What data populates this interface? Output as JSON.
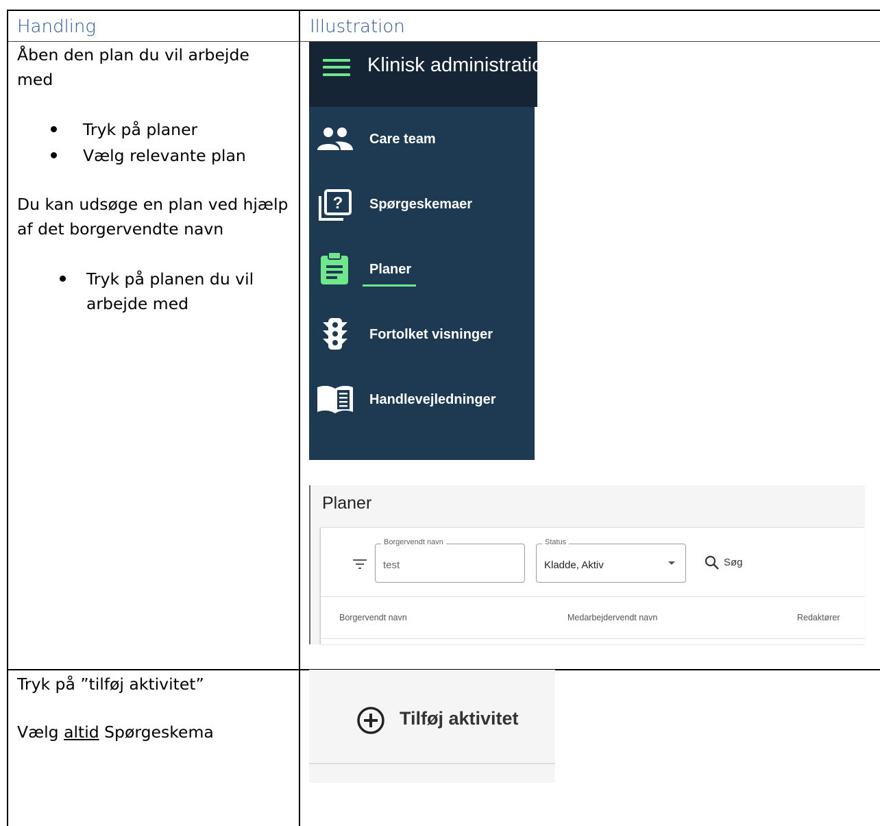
{
  "table": {
    "headers": [
      "Handling",
      "Illustration"
    ]
  },
  "row1": {
    "intro": [
      "Åben den plan du vil arbejde",
      "med"
    ],
    "bullets": [
      "Tryk på planer",
      "Vælg relevante plan"
    ],
    "para": [
      "Du kan udsøge en plan ved hjælp",
      "af det borgervendte navn"
    ],
    "bullet2": [
      "Tryk på planen du vil",
      "arbejde med"
    ]
  },
  "row2": {
    "line1": "Tryk på ”tilføj aktivitet”",
    "line2_pre": "Vælg ",
    "line2_underlined": "altid",
    "line2_post": " Spørgeskema"
  },
  "app": {
    "topbar_title": "Klinisk administration",
    "nav": [
      {
        "label": "Care team",
        "icon": "people-icon"
      },
      {
        "label": "Spørgeskemaer",
        "icon": "question-stack-icon"
      },
      {
        "label": "Planer",
        "icon": "clipboard-icon",
        "active": true
      },
      {
        "label": "Fortolket visninger",
        "icon": "traffic-light-icon"
      },
      {
        "label": "Handlevejledninger",
        "icon": "book-icon"
      }
    ],
    "accent": "#6ee88a",
    "sidebar_bg": "#1e3952",
    "topbar_bg": "#152536"
  },
  "planer": {
    "title": "Planer",
    "filter": {
      "name_label": "Borgervendt navn",
      "name_value": "test",
      "status_label": "Status",
      "status_value": "Kladde, Aktiv",
      "search_label": "Søg"
    },
    "columns": [
      "Borgervendt navn",
      "Medarbejdervendt navn",
      "Redaktører"
    ]
  },
  "add_activity": {
    "label": "Tilføj aktivitet"
  }
}
